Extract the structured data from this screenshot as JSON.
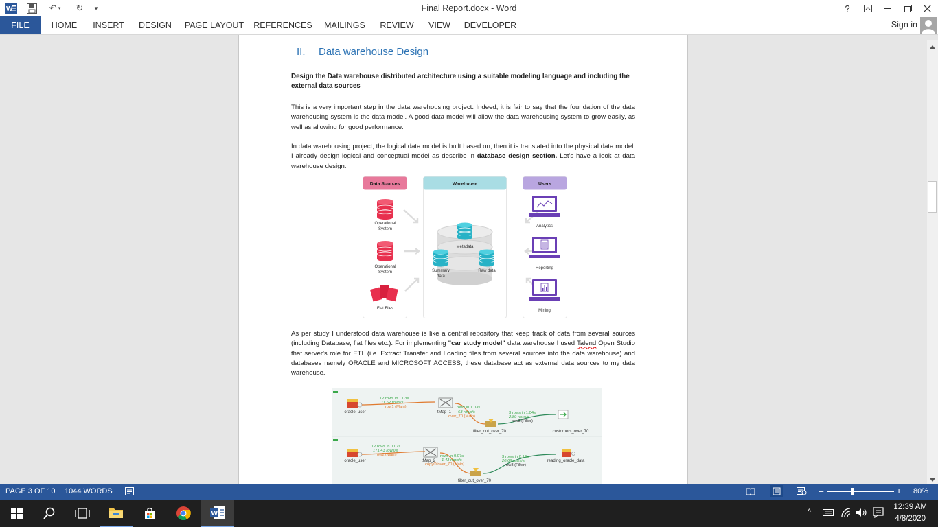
{
  "window": {
    "title": "Final Report.docx - Word",
    "help": "?",
    "sign_in": "Sign in"
  },
  "ribbon_tabs": [
    "FILE",
    "HOME",
    "INSERT",
    "DESIGN",
    "PAGE LAYOUT",
    "REFERENCES",
    "MAILINGS",
    "REVIEW",
    "VIEW",
    "DEVELOPER"
  ],
  "document": {
    "section_number": "II.",
    "section_title": "Data warehouse Design",
    "bold_intro": "Design the Data warehouse distributed architecture using a suitable modeling language and including the external data sources",
    "para1": "This is a very important step in the data warehousing project. Indeed, it is fair to say that the foundation of the data warehousing system is the data model. A good data model will allow the data warehousing system to grow easily, as well as allowing for good performance.",
    "para2_a": "In data warehousing project, the logical data model is built based on, then it is translated into the physical data model. I already design logical and conceptual model as describe in ",
    "para2_b": "database design section.",
    "para2_c": " Let's have a look at data warehouse design.",
    "para3_a": "As per study I understood data warehouse is like a central repository that keep track of data from several sources (including Database, flat files etc.). For implementing ",
    "para3_b": "\"car study model\"",
    "para3_c": " data warehouse I used ",
    "para3_d": "Talend",
    "para3_e": " Open Studio that server's role for ETL (i.e. Extract Transfer and Loading files from several sources into the data warehouse) and databases namely ORACLE and MICROSOFT ACCESS, these database act as external data sources to my data warehouse."
  },
  "diagram": {
    "col_sources": "Data Sources",
    "col_warehouse": "Warehouse",
    "col_users": "Users",
    "src1": [
      "Operational",
      "System"
    ],
    "src2": [
      "Operational",
      "System"
    ],
    "src3": "Flat Files",
    "metadata": "Metadata",
    "summary": [
      "Summary",
      "data"
    ],
    "raw": "Raw data",
    "user1": "Analytics",
    "user2": "Reporting",
    "user3": "Mining"
  },
  "etl": {
    "flow1": {
      "src": "oracle_user",
      "l1": "12 rows in 1.03s",
      "l2": "11.62 rows/s",
      "l3": "row1 (Main)",
      "tmap": "tMap_1",
      "m1": "rows in 1.03s",
      "m2": "63 rows/s",
      "m3": "over_70 (Main)",
      "r1": "3 rows in 1.04s",
      "r2": "2.89 rows/s",
      "r3": "row3 (Filter)",
      "filter": "filter_out_over_70",
      "target": "customers_over_70"
    },
    "flow2": {
      "src": "oracle_user",
      "l1": "12 rows in 0.07s",
      "l2": "171.43 rows/s",
      "l3": "row2 (Main)",
      "tmap": "tMap_2",
      "m1": "rows in 0.07s",
      "m2": "1.43 rows/s",
      "m3": "copyOfover_70 (Main)",
      "r1": "3 rows in 0.14s",
      "r2": "20.69 rows/s",
      "r3": "row3 (Filter)",
      "filter": "filter_out_over_70",
      "target": "reading_oracle_data"
    }
  },
  "status": {
    "page": "PAGE 3 OF 10",
    "words": "1044 WORDS",
    "zoom": "80%"
  },
  "clock": {
    "time": "12:39 AM",
    "date": "4/8/2020"
  },
  "colors": {
    "accent": "#2b579a",
    "heading": "#2e74b5",
    "sources": "#e8799b",
    "warehouse": "#a9dde4",
    "users": "#b9a6e0"
  }
}
